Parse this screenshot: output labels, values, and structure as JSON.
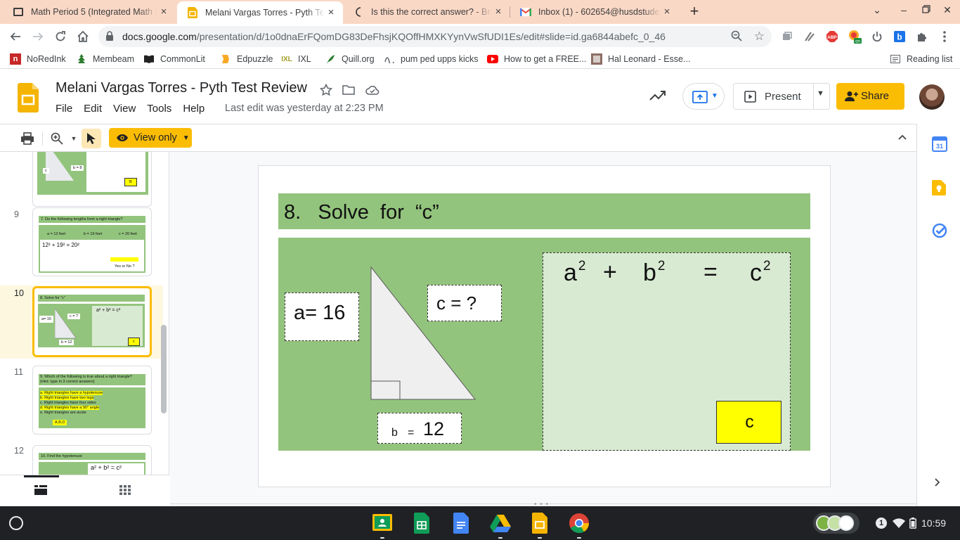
{
  "tabs": [
    {
      "title": "Math Period 5 (Integrated Math I",
      "icon": "classroom-icon"
    },
    {
      "title": "Melani Vargas Torres - Pyth Test",
      "icon": "slides-icon",
      "active": true
    },
    {
      "title": "Is this the correct answer? - Brainly",
      "icon": "brainly-icon"
    },
    {
      "title": "Inbox (1) - 602654@husdstudent",
      "icon": "gmail-icon"
    }
  ],
  "omnibox": {
    "domain": "docs.google.com",
    "path": "/presentation/d/1o0dnaErFQomDG83DeFhsjKQOffHMXKYynVwSfUDI1Es/edit#slide=id.ga6844abefc_0_46"
  },
  "bookmarks": [
    {
      "label": "NoRedInk",
      "icon": "noredink-icon"
    },
    {
      "label": "Membeam",
      "icon": "membean-icon"
    },
    {
      "label": "CommonLit",
      "icon": "commonlit-icon"
    },
    {
      "label": "Edpuzzle",
      "icon": "edpuzzle-icon"
    },
    {
      "label": "IXL",
      "icon": "ixl-icon"
    },
    {
      "label": "Quill.org",
      "icon": "quill-icon"
    },
    {
      "label": "pum ped upps kicks",
      "icon": "link-icon"
    },
    {
      "label": "How to get a FREE...",
      "icon": "youtube-icon"
    },
    {
      "label": "Hal Leonard - Esse...",
      "icon": "hal-leonard-icon"
    }
  ],
  "reading_list": "Reading list",
  "app": {
    "doc_title": "Melani Vargas Torres - Pyth Test Review",
    "menu": [
      "File",
      "Edit",
      "View",
      "Tools",
      "Help"
    ],
    "last_edit": "Last edit was yesterday at 2:23 PM",
    "present_label": "Present",
    "share_label": "Share",
    "view_only_label": "View only"
  },
  "colors": {
    "accent": "#fbbc04",
    "slide_green": "#93c47d",
    "work_green": "#d9ead3",
    "answer_yellow": "#ffff00"
  },
  "filmstrip": {
    "slides": [
      {
        "num": "",
        "mini": [
          "c",
          "b = 8",
          "B"
        ]
      },
      {
        "num": "9",
        "mini": [
          "7.  Do the following lengths form a right triangle?",
          "a  =  12 feet",
          "b  =  19 feet",
          "c  =  20 feet",
          "12²    +    19²    =    20²",
          "Yes   or   No  ?"
        ]
      },
      {
        "num": "10",
        "mini": [
          "8.  Solve for \"c\"",
          "a= 16",
          "c = ?",
          "b = 12",
          "a² + b² = c²",
          "c"
        ]
      },
      {
        "num": "11",
        "mini": [
          "9. Which of the following is true about a right triangle?",
          "(Hint: type in 3 correct answers)",
          "a.  Right triangles have a hypotenuse",
          "b.  Right triangles have two legs",
          "c.  Right triangles have four sides",
          "d.  Right triangles have a 90° angle",
          "e.  Right triangles are acute",
          "A,B,D"
        ]
      },
      {
        "num": "12",
        "mini": [
          "10.  Find the hypotenuse",
          "a² + b² = c²"
        ]
      }
    ]
  },
  "slide": {
    "title": "8.   Solve  for  “c”",
    "a_label": "a= 16",
    "c_label": "c = ?",
    "b_letter": "b",
    "b_eq": "=",
    "b_value": "12",
    "eq": {
      "a": "a",
      "plus": "+",
      "b": "b",
      "equals": "=",
      "c": "c",
      "exp": "2"
    },
    "answer": "c"
  },
  "shelf": {
    "time": "10:59",
    "notification_count": "1",
    "apps": [
      "classroom-icon",
      "sheets-icon",
      "docs-icon",
      "drive-icon",
      "slides-icon",
      "chrome-icon"
    ]
  }
}
